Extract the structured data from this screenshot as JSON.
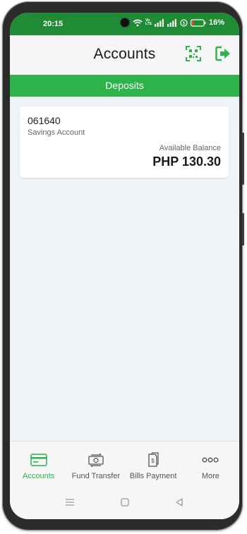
{
  "status_bar": {
    "time": "20:15",
    "battery_percent": "16%",
    "battery_level": 0.16,
    "network_label": "Vo LTE"
  },
  "header": {
    "title": "Accounts",
    "icons": [
      "qr-scan-icon",
      "logout-icon"
    ]
  },
  "tabs": {
    "active": "Deposits"
  },
  "account_card": {
    "account_number": "061640",
    "account_type": "Savings Account",
    "balance_label": "Available Balance",
    "balance": "PHP 130.30"
  },
  "bottom_nav": {
    "items": [
      {
        "label": "Accounts",
        "icon": "card-icon",
        "active": true
      },
      {
        "label": "Fund Transfer",
        "icon": "money-transfer-icon",
        "active": false
      },
      {
        "label": "Bills Payment",
        "icon": "bills-icon",
        "active": false
      },
      {
        "label": "More",
        "icon": "more-dots-icon",
        "active": false
      }
    ]
  },
  "colors": {
    "status_bar": "#1f8b35",
    "accent": "#2db34a",
    "content_bg": "#eff2f6"
  }
}
